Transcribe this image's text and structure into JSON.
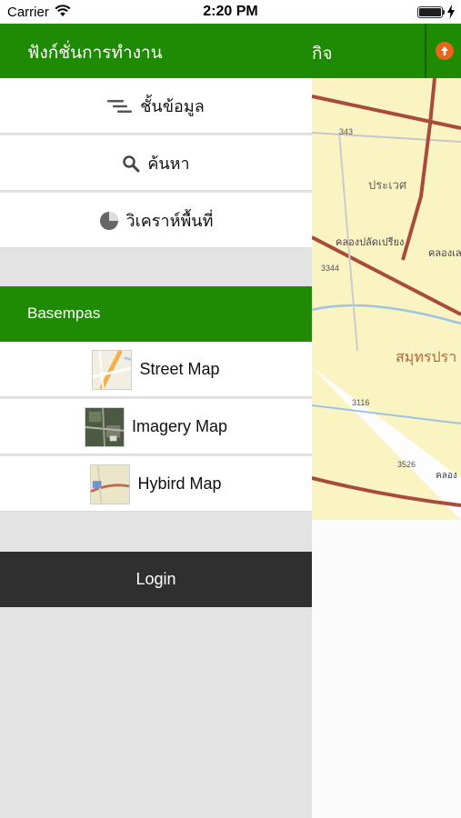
{
  "status_bar": {
    "carrier": "Carrier",
    "time": "2:20 PM"
  },
  "map": {
    "header_title": "กิจ",
    "upload_icon": "upload-icon",
    "accent": "#e9641c",
    "labels": [
      "343",
      "ประเวศ",
      "คลองปลัดเปรียง",
      "คลองเล",
      "3344",
      "สมุทรปรา",
      "3116",
      "3526",
      "คลอง"
    ]
  },
  "drawer": {
    "title": "ฟังก์ชั่นการทำงาน",
    "menu_items": [
      {
        "label": "ชั้นข้อมูล",
        "icon": "layers-icon"
      },
      {
        "label": "ค้นหา",
        "icon": "search-icon"
      },
      {
        "label": "วิเคราห์พื้นที่",
        "icon": "pie-chart-icon"
      }
    ],
    "basemaps_header": "Basempas",
    "basemaps": [
      {
        "label": "Street Map",
        "icon": "street-map-thumbnail"
      },
      {
        "label": "Imagery Map",
        "icon": "imagery-map-thumbnail"
      },
      {
        "label": "Hybird Map",
        "icon": "hybrid-map-thumbnail"
      }
    ],
    "login_label": "Login"
  },
  "colors": {
    "header_green": "#1f8a03",
    "login_dark": "#2f2f2f",
    "drawer_bg": "#e3e3e3"
  }
}
